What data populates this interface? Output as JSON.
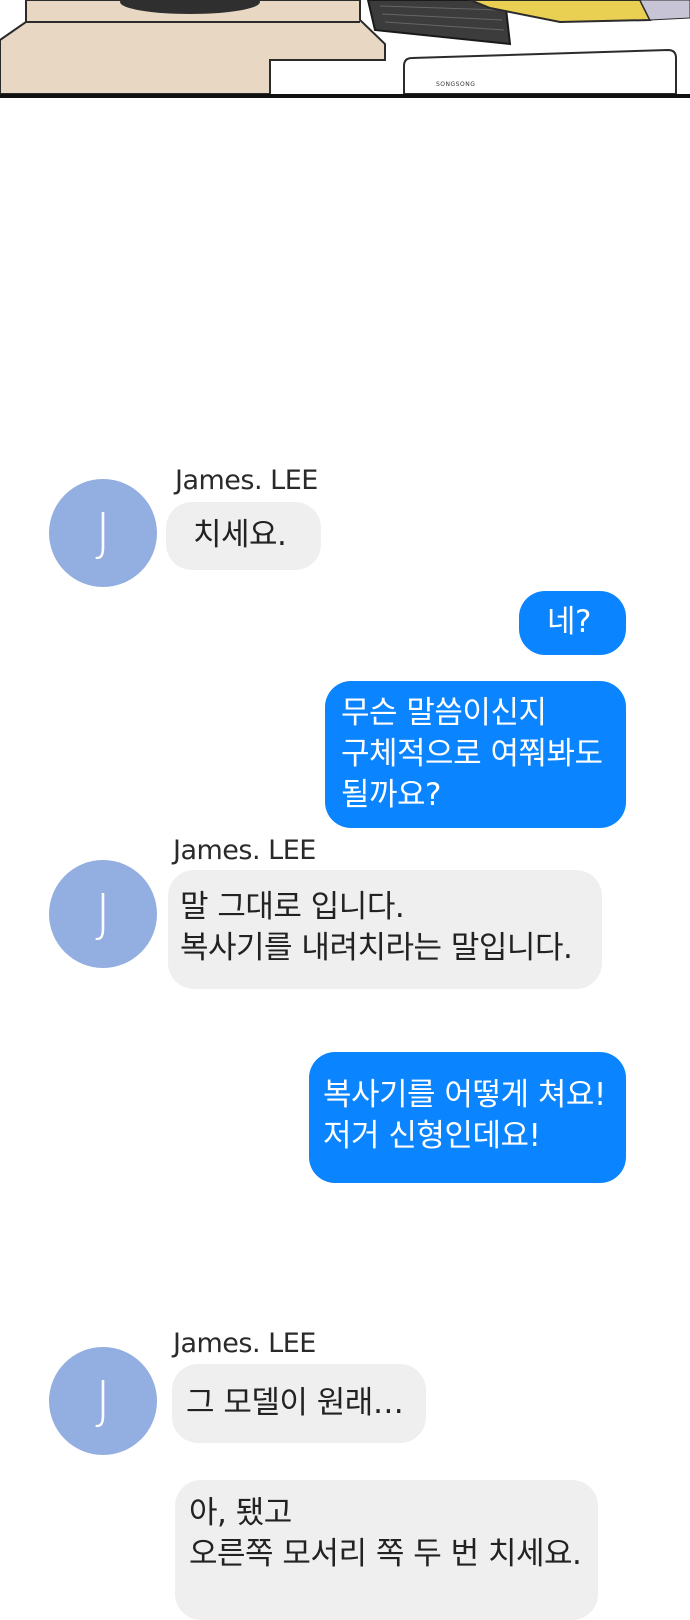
{
  "panel": {
    "monitor_brand": "SONGSONG",
    "colors": {
      "desk": "#e8d7c3",
      "keyboard": "#3c3c3c",
      "shirt": "#e9cf52",
      "border": "#111111"
    }
  },
  "chat": {
    "colors": {
      "incoming": "#efefef",
      "outgoing": "#0a84ff",
      "avatar": "#93aee0"
    },
    "messages": [
      {
        "sender": "James. LEE",
        "avatar_letter": "J",
        "lines": [
          "치세요."
        ]
      },
      {
        "lines": [
          "네?"
        ]
      },
      {
        "lines": [
          "무슨 말씀이신지",
          "구체적으로 여쭤봐도",
          "될까요?"
        ]
      },
      {
        "sender": "James. LEE",
        "avatar_letter": "J",
        "lines": [
          "말 그대로 입니다.",
          "복사기를 내려치라는 말입니다."
        ]
      },
      {
        "lines": [
          "복사기를 어떻게 쳐요!",
          "저거 신형인데요!"
        ]
      },
      {
        "sender": "James. LEE",
        "avatar_letter": "J",
        "lines": [
          "그 모델이 원래…"
        ]
      },
      {
        "lines": [
          "아, 됐고",
          "오른쪽 모서리 쪽 두 번 치세요."
        ]
      }
    ]
  }
}
